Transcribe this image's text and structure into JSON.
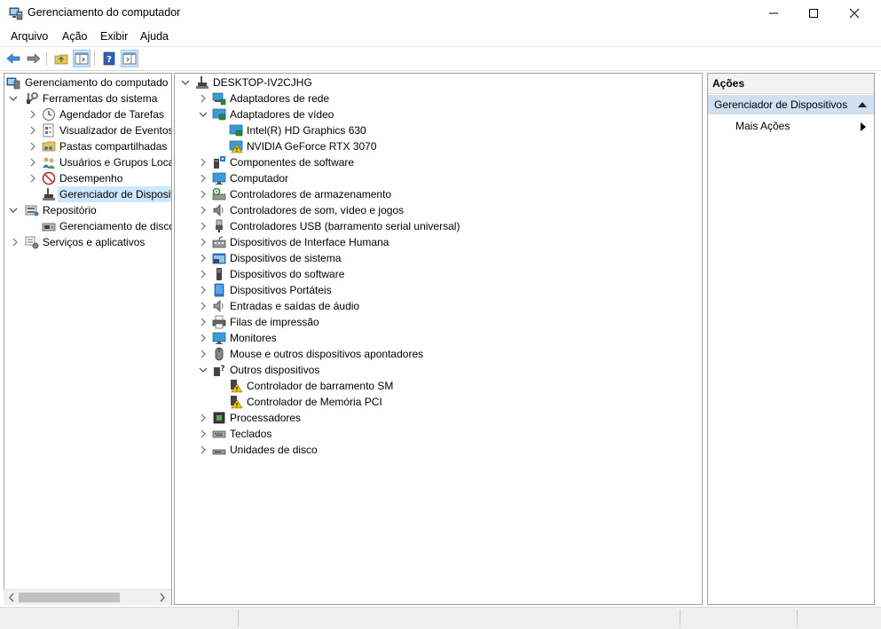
{
  "window": {
    "title": "Gerenciamento do computador",
    "controls": [
      "minimize-icon",
      "maximize-icon",
      "close-icon"
    ]
  },
  "menu": [
    "Arquivo",
    "Ação",
    "Exibir",
    "Ajuda"
  ],
  "toolbar": [
    "back-arrow-icon",
    "forward-arrow-icon",
    "up-folder-icon",
    "show-hide-tree-icon",
    "help-icon",
    "show-action-pane-icon"
  ],
  "left_tree": {
    "root": "Gerenciamento do computado",
    "nodes": [
      {
        "label": "Ferramentas do sistema"
      },
      {
        "label": "Agendador de Tarefas"
      },
      {
        "label": "Visualizador de Eventos"
      },
      {
        "label": "Pastas compartilhadas"
      },
      {
        "label": "Usuários e Grupos Loca"
      },
      {
        "label": "Desempenho"
      },
      {
        "label": "Gerenciador de Disposit"
      },
      {
        "label": "Repositório"
      },
      {
        "label": "Gerenciamento de disco"
      },
      {
        "label": "Serviços e aplicativos"
      }
    ]
  },
  "device_tree": {
    "root": "DESKTOP-IV2CJHG",
    "items": [
      {
        "label": "Adaptadores de rede"
      },
      {
        "label": "Adaptadores de vídeo"
      },
      {
        "label": "Intel(R) HD Graphics 630"
      },
      {
        "label": "NVIDIA GeForce RTX 3070"
      },
      {
        "label": "Componentes de software"
      },
      {
        "label": "Computador"
      },
      {
        "label": "Controladores de armazenamento"
      },
      {
        "label": "Controladores de som, vídeo e jogos"
      },
      {
        "label": "Controladores USB (barramento serial universal)"
      },
      {
        "label": "Dispositivos de Interface Humana"
      },
      {
        "label": "Dispositivos de sistema"
      },
      {
        "label": "Dispositivos do software"
      },
      {
        "label": "Dispositivos Portáteis"
      },
      {
        "label": "Entradas e saídas de áudio"
      },
      {
        "label": "Filas de impressão"
      },
      {
        "label": "Monitores"
      },
      {
        "label": "Mouse e outros dispositivos apontadores"
      },
      {
        "label": "Outros dispositivos"
      },
      {
        "label": "Controlador de barramento SM"
      },
      {
        "label": "Controlador de Memória PCI"
      },
      {
        "label": "Processadores"
      },
      {
        "label": "Teclados"
      },
      {
        "label": "Unidades de disco"
      }
    ]
  },
  "actions": {
    "header": "Ações",
    "group": "Gerenciador de Dispositivos",
    "item": "Mais Ações"
  },
  "colors": {
    "selection": "#cce8ff",
    "action_group": "#cfe0f1",
    "warning": "#f5c400"
  }
}
